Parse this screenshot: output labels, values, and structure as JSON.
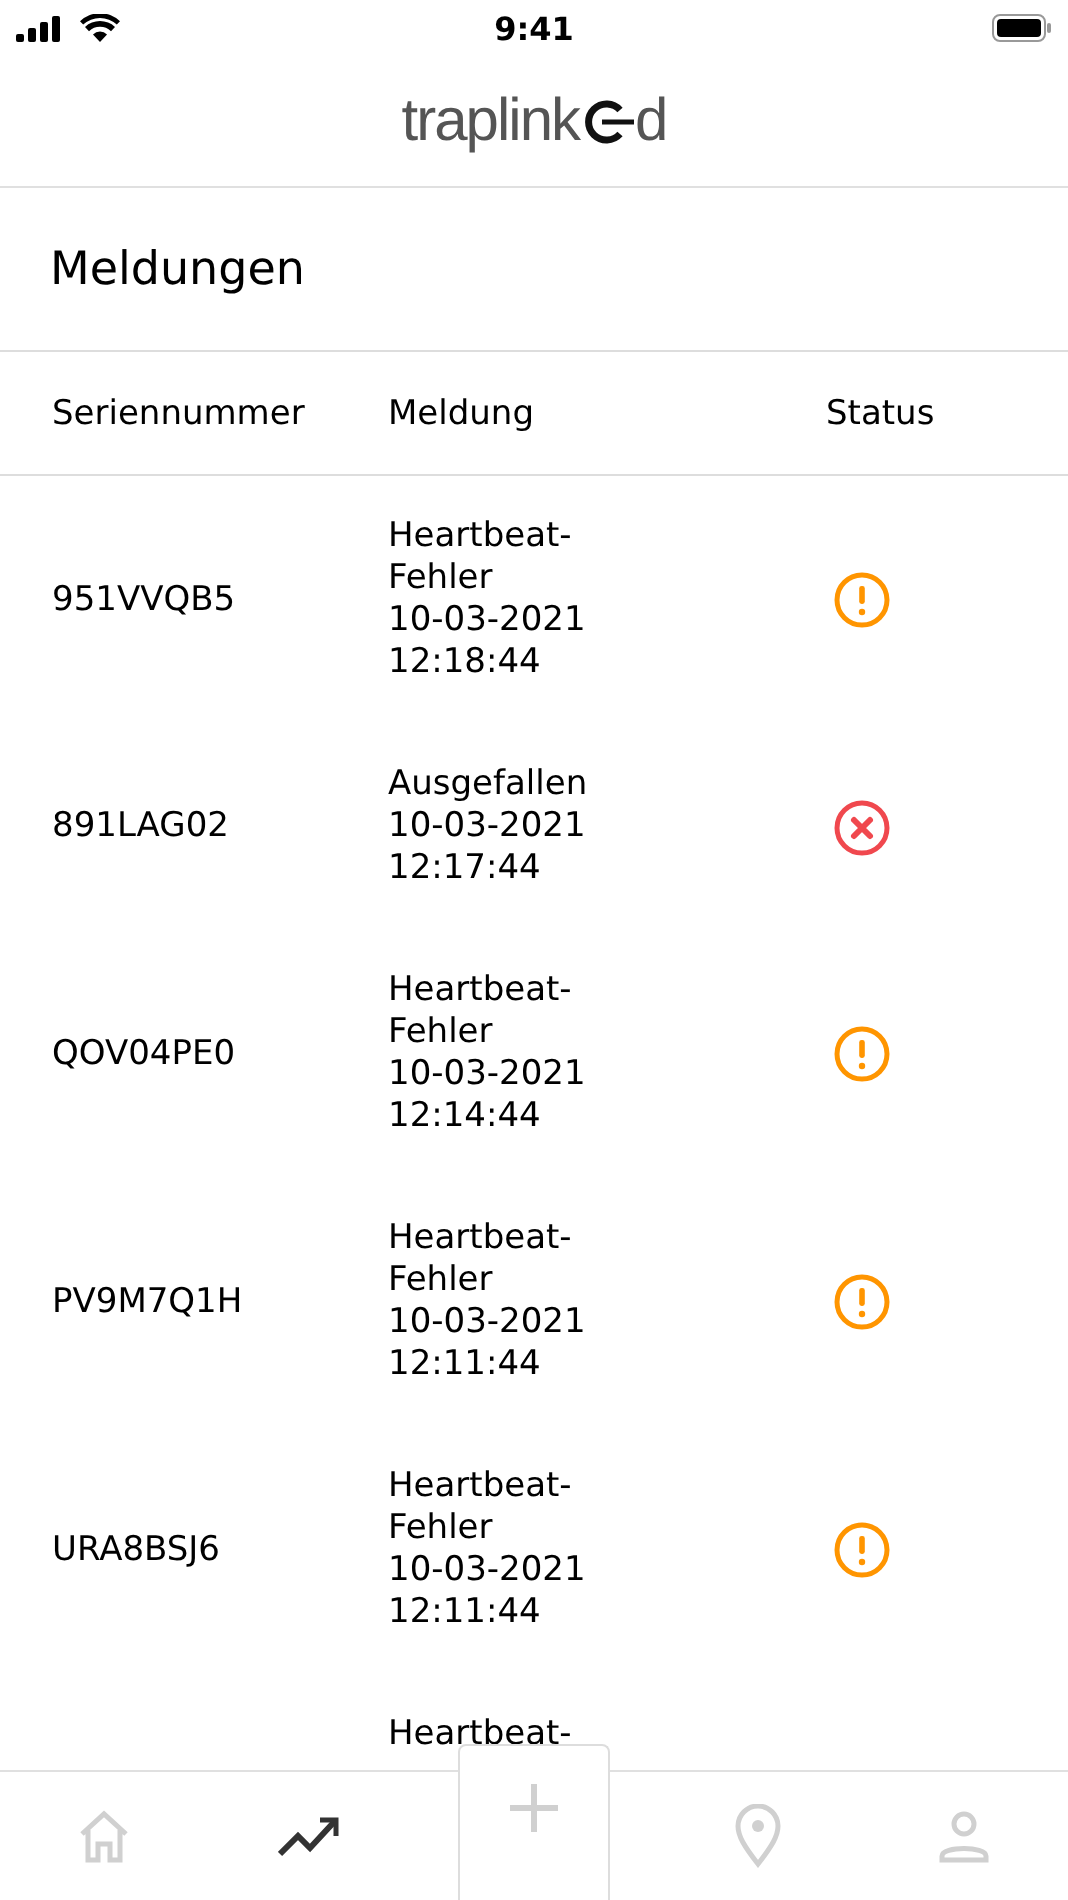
{
  "status_bar": {
    "time": "9:41"
  },
  "logo": {
    "prefix": "traplink",
    "suffix": "d"
  },
  "title": "Meldungen",
  "table": {
    "columns": [
      "Seriennummer",
      "Meldung",
      "Status"
    ],
    "rows": [
      {
        "serial": "951VVQB5",
        "message": "Heartbeat-Fehler",
        "date": "10-03-2021",
        "time": "12:18:44",
        "kind": "warning"
      },
      {
        "serial": "891LAG02",
        "message": "Ausgefallen",
        "date": "10-03-2021",
        "time": "12:17:44",
        "kind": "error"
      },
      {
        "serial": "QOV04PE0",
        "message": "Heartbeat-Fehler",
        "date": "10-03-2021",
        "time": "12:14:44",
        "kind": "warning"
      },
      {
        "serial": "PV9M7Q1H",
        "message": "Heartbeat-Fehler",
        "date": "10-03-2021",
        "time": "12:11:44",
        "kind": "warning"
      },
      {
        "serial": "URA8BSJ6",
        "message": "Heartbeat-Fehler",
        "date": "10-03-2021",
        "time": "12:11:44",
        "kind": "warning"
      },
      {
        "message": "Heartbeat-"
      }
    ]
  },
  "tab_bar": [
    {
      "kind": "home",
      "selected": false
    },
    {
      "kind": "chart",
      "selected": true
    },
    {
      "kind": "add",
      "selected": false
    },
    {
      "kind": "location",
      "selected": false
    },
    {
      "kind": "profile",
      "selected": false
    }
  ]
}
